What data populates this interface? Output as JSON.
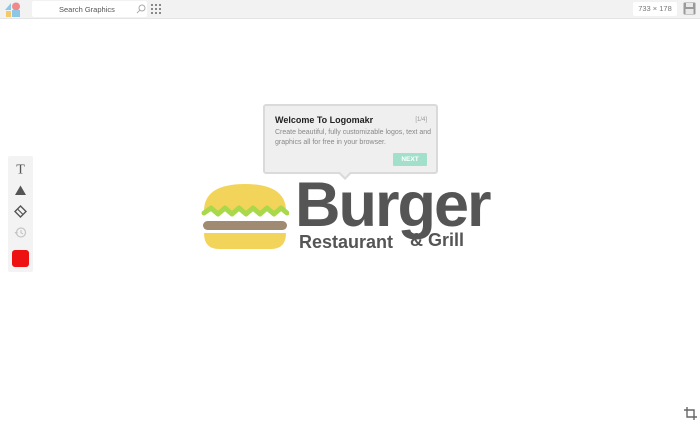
{
  "toolbar": {
    "search_placeholder": "Search Graphics",
    "dimensions": "733 × 178"
  },
  "left_tools": {
    "items": [
      "text-tool",
      "shape-tool",
      "eraser-tool",
      "history-tool"
    ],
    "color": "#ee1111"
  },
  "logo": {
    "brand_name": "Burger",
    "tagline_1": "Restaurant",
    "tagline_2": "& Grill"
  },
  "tooltip": {
    "title": "Welcome To Logomakr",
    "step": "[1/4]",
    "body": "Create beautiful, fully customizable logos, text and graphics all for free in your browser.",
    "next_label": "NEXT"
  },
  "colors": {
    "bun": "#f3d45b",
    "lettuce": "#a9d84a",
    "patty": "#a08a72",
    "text": "#555555",
    "accent": "#a3e0cb"
  },
  "icons": [
    "app-logo-icon",
    "search-icon",
    "grid-icon",
    "save-icon",
    "text-tool-icon",
    "shape-tool-icon",
    "eraser-tool-icon",
    "history-icon",
    "crop-icon"
  ]
}
